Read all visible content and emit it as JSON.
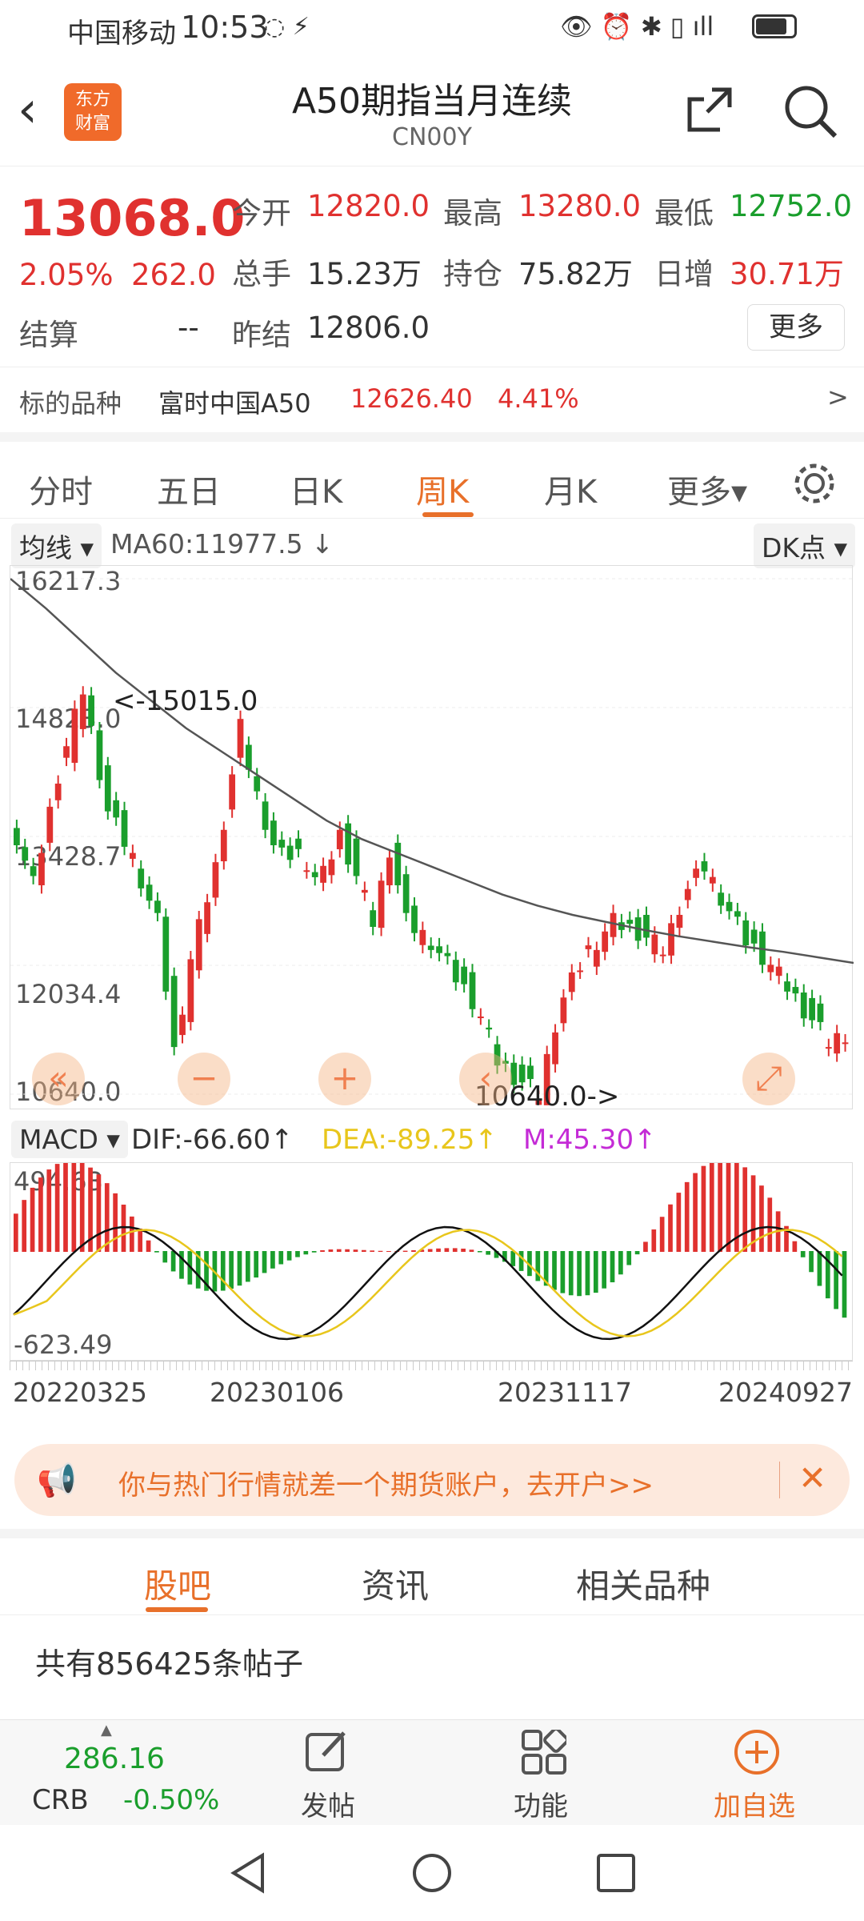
{
  "status": {
    "carrier": "中国移动",
    "time": "10:53",
    "battery": "85"
  },
  "header": {
    "logo_line1": "东方",
    "logo_line2": "财富",
    "title": "A50期指当月连续",
    "code": "CN00Y"
  },
  "quote": {
    "price": "13068.0",
    "pct": "2.05%",
    "chg": "262.0",
    "open_label": "今开",
    "open": "12820.0",
    "high_label": "最高",
    "high": "13280.0",
    "low_label": "最低",
    "low": "12752.0",
    "vol_label": "总手",
    "vol": "15.23万",
    "oi_label": "持仓",
    "oi": "75.82万",
    "inc_label": "日增",
    "inc": "30.71万",
    "settle_label": "结算",
    "settle": "--",
    "prev_label": "昨结",
    "prev": "12806.0",
    "more": "更多",
    "underlying_label": "标的品种",
    "underlying_name": "富时中国A50",
    "underlying_price": "12626.40",
    "underlying_pct": "4.41%",
    "arrow": ">"
  },
  "tabs": [
    "分时",
    "五日",
    "日K",
    "周K",
    "月K",
    "更多▾"
  ],
  "active_tab": "周K",
  "indicator": {
    "ma_btn": "均线",
    "ma_text": "MA60:11977.5 ↓",
    "dk_btn": "DK点"
  },
  "chart_data": {
    "type": "candlestick",
    "y_ticks": [
      "16217.3",
      "14823.0",
      "13428.7",
      "12034.4",
      "10640.0"
    ],
    "ylim": [
      10640.0,
      16217.3
    ],
    "annotation_high": "<-15015.0",
    "annotation_low": "10640.0->",
    "x_labels": [
      "20220325",
      "20230106",
      "20231117",
      "20240927"
    ],
    "ma60": [
      16217,
      15900,
      15550,
      15200,
      14900,
      14600,
      14350,
      14100,
      13850,
      13600,
      13400,
      13250,
      13100,
      12950,
      12800,
      12680,
      12580,
      12500,
      12420,
      12350,
      12290,
      12230,
      12180,
      12120,
      12060
    ],
    "macd": {
      "label": "MACD",
      "dif": "DIF:-66.60↑",
      "dea": "DEA:-89.25↑",
      "m": "M:45.30↑",
      "top": "494.63",
      "bottom": "-623.49"
    }
  },
  "colors": {
    "up": "#e0312f",
    "down": "#1a9e2c",
    "accent": "#e8702a",
    "dea": "#e8c61c",
    "m": "#c42bd6"
  },
  "banner": {
    "text": "你与热门行情就差一个期货账户，去开户>>",
    "close": "✕"
  },
  "subtabs": [
    "股吧",
    "资讯",
    "相关品种"
  ],
  "posts": "共有856425条帖子",
  "bottom": {
    "crb_value": "286.16",
    "crb_label": "CRB",
    "crb_pct": "-0.50%",
    "post": "发帖",
    "func": "功能",
    "add": "加自选"
  }
}
